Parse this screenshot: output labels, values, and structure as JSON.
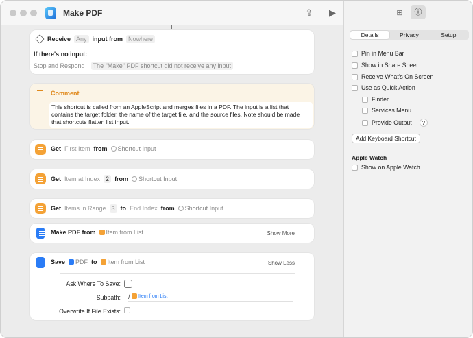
{
  "window": {
    "title": "Make PDF"
  },
  "receive": {
    "label": "Receive",
    "types": "Any",
    "input_from": "input from",
    "source": "Nowhere",
    "no_input_label": "If there's no input:",
    "action": "Stop and Respond",
    "message": "The \"Make\" PDF shortcut did not receive any input"
  },
  "comment": {
    "title": "Comment",
    "text": "This shortcut is called from an AppleScript and merges files in a PDF. The input is a list that contains the target folder, the name of the target file, and the source files. Note should be made that shortcuts flatten list input."
  },
  "get1": {
    "kw": "Get",
    "item": "First Item",
    "from": "from",
    "source": "Shortcut Input"
  },
  "get2": {
    "kw": "Get",
    "item": "Item at Index",
    "index": "2",
    "from": "from",
    "source": "Shortcut Input"
  },
  "get3": {
    "kw": "Get",
    "item": "Items in Range",
    "start": "3",
    "to": "to",
    "end": "End Index",
    "from": "from",
    "source": "Shortcut Input"
  },
  "makepdf": {
    "kw": "Make PDF from",
    "source": "Item from List",
    "show_more": "Show More"
  },
  "save": {
    "kw": "Save",
    "type": "PDF",
    "to": "to",
    "dest": "Item from List",
    "show_less": "Show Less",
    "ask_label": "Ask Where To Save:",
    "subpath_label": "Subpath:",
    "subpath_prefix": "/",
    "subpath_value": "Item from List",
    "overwrite_label": "Overwrite If File Exists:"
  },
  "sidebar": {
    "tabs": [
      "Details",
      "Privacy",
      "Setup"
    ],
    "options": [
      "Pin in Menu Bar",
      "Show in Share Sheet",
      "Receive What's On Screen",
      "Use as Quick Action"
    ],
    "sub_options": [
      "Finder",
      "Services Menu",
      "Provide Output"
    ],
    "help": "?",
    "keyboard_button": "Add Keyboard Shortcut",
    "watch_header": "Apple Watch",
    "watch_option": "Show on Apple Watch"
  }
}
